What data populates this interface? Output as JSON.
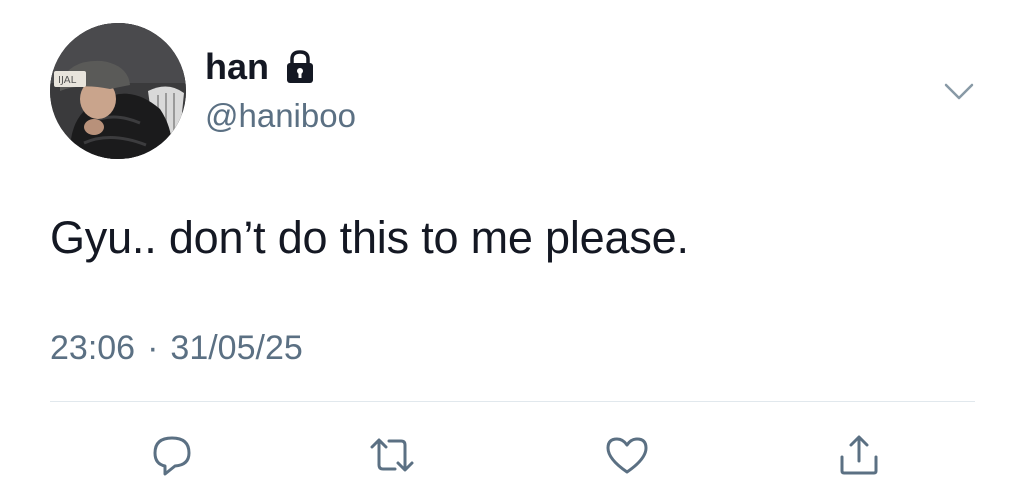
{
  "user": {
    "display_name": "han",
    "handle": "@haniboo",
    "locked_icon": "lock-icon",
    "avatar_alt": "profile photo"
  },
  "tweet": {
    "text": "Gyu.. don’t do this to me please.",
    "time": "23:06",
    "separator": "·",
    "date": "31/05/25"
  },
  "menu": {
    "icon": "chevron-down-icon"
  },
  "actions": [
    {
      "icon": "reply-icon"
    },
    {
      "icon": "retweet-icon"
    },
    {
      "icon": "like-icon"
    },
    {
      "icon": "share-icon"
    }
  ],
  "colors": {
    "text": "#141823",
    "secondary": "#5b7083",
    "divider": "#e1e8ed"
  }
}
